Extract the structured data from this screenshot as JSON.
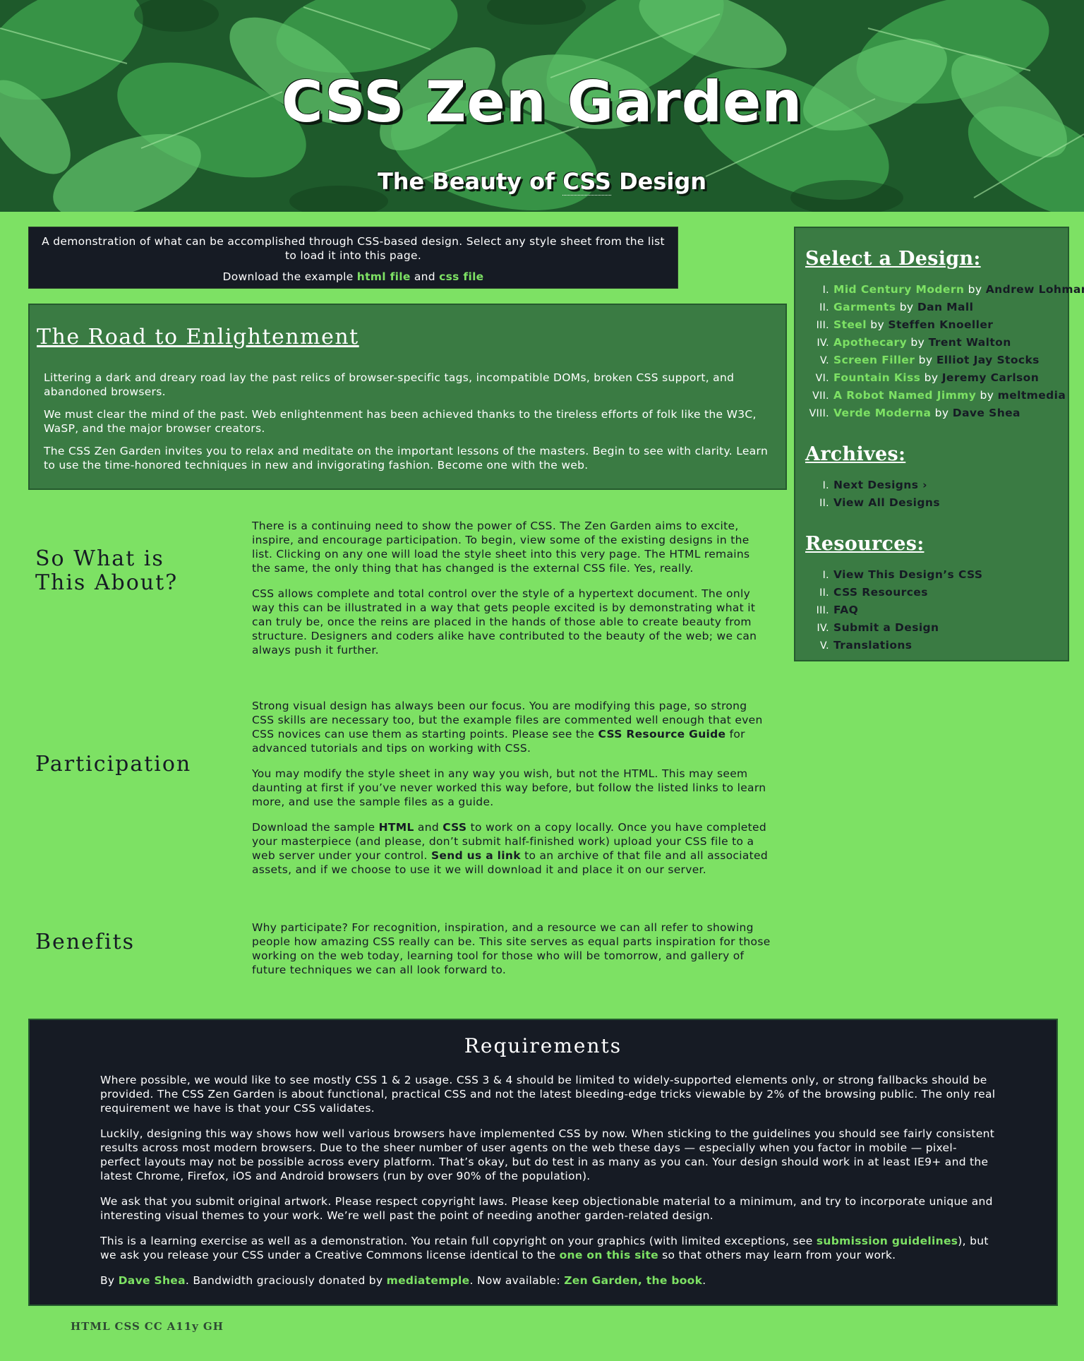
{
  "header": {
    "title": "CSS Zen Garden",
    "subtitle_prefix": "The Beauty of ",
    "subtitle_abbr": "CSS",
    "subtitle_suffix": " Design"
  },
  "intro": {
    "text": "A demonstration of what can be accomplished through CSS-based design. Select any style sheet from the list to load it into this page.",
    "download_prefix": "Download the example ",
    "html_link": "html file",
    "and": " and ",
    "css_link": "css file"
  },
  "road": {
    "title": "The Road to Enlightenment",
    "p1": "Littering a dark and dreary road lay the past relics of browser-specific tags, incompatible DOMs, broken CSS support, and abandoned browsers.",
    "p2": "We must clear the mind of the past. Web enlightenment has been achieved thanks to the tireless efforts of folk like the W3C, WaSP, and the major browser creators.",
    "p3": "The CSS Zen Garden invites you to relax and meditate on the important lessons of the masters. Begin to see with clarity. Learn to use the time-honored techniques in new and invigorating fashion. Become one with the web."
  },
  "about": {
    "title": "So What is This About?",
    "p1": "There is a continuing need to show the power of CSS. The Zen Garden aims to excite, inspire, and encourage participation. To begin, view some of the existing designs in the list. Clicking on any one will load the style sheet into this very page. The HTML remains the same, the only thing that has changed is the external CSS file. Yes, really.",
    "p2": "CSS allows complete and total control over the style of a hypertext document. The only way this can be illustrated in a way that gets people excited is by demonstrating what it can truly be, once the reins are placed in the hands of those able to create beauty from structure. Designers and coders alike have contributed to the beauty of the web; we can always push it further."
  },
  "participation": {
    "title": "Participation",
    "p1_a": "Strong visual design has always been our focus. You are modifying this page, so strong CSS skills are necessary too, but the example files are commented well enough that even CSS novices can use them as starting points. Please see the ",
    "p1_link": "CSS Resource Guide",
    "p1_b": " for advanced tutorials and tips on working with CSS.",
    "p2": "You may modify the style sheet in any way you wish, but not the HTML. This may seem daunting at first if you’ve never worked this way before, but follow the listed links to learn more, and use the sample files as a guide.",
    "p3_a": "Download the sample ",
    "p3_html": "HTML",
    "p3_and": " and ",
    "p3_css": "CSS",
    "p3_b": " to work on a copy locally. Once you have completed your masterpiece (and please, don’t submit half-finished work) upload your CSS file to a web server under your control. ",
    "p3_link": "Send us a link",
    "p3_c": " to an archive of that file and all associated assets, and if we choose to use it we will download it and place it on our server."
  },
  "benefits": {
    "title": "Benefits",
    "p1": "Why participate? For recognition, inspiration, and a resource we can all refer to showing people how amazing CSS really can be. This site serves as equal parts inspiration for those working on the web today, learning tool for those who will be tomorrow, and gallery of future techniques we can all look forward to."
  },
  "sidebar": {
    "select_title": "Select a Design:",
    "designs": [
      {
        "num": "I.",
        "name": "Mid Century Modern",
        "by": "by",
        "author": "Andrew Lohman"
      },
      {
        "num": "II.",
        "name": "Garments",
        "by": "by",
        "author": "Dan Mall"
      },
      {
        "num": "III.",
        "name": "Steel",
        "by": "by",
        "author": "Steffen Knoeller"
      },
      {
        "num": "IV.",
        "name": "Apothecary",
        "by": "by",
        "author": "Trent Walton"
      },
      {
        "num": "V.",
        "name": "Screen Filler",
        "by": "by",
        "author": "Elliot Jay Stocks"
      },
      {
        "num": "VI.",
        "name": "Fountain Kiss",
        "by": "by",
        "author": "Jeremy Carlson"
      },
      {
        "num": "VII.",
        "name": "A Robot Named Jimmy",
        "by": "by",
        "author": "meltmedia"
      },
      {
        "num": "VIII.",
        "name": "Verde Moderna",
        "by": "by",
        "author": "Dave Shea"
      }
    ],
    "archives_title": "Archives:",
    "archives": [
      {
        "num": "I.",
        "label": "Next Designs ›"
      },
      {
        "num": "II.",
        "label": "View All Designs"
      }
    ],
    "resources_title": "Resources:",
    "resources": [
      {
        "num": "I.",
        "label": "View This Design’s CSS"
      },
      {
        "num": "II.",
        "label": "CSS Resources"
      },
      {
        "num": "III.",
        "label": "FAQ"
      },
      {
        "num": "IV.",
        "label": "Submit a Design"
      },
      {
        "num": "V.",
        "label": "Translations"
      }
    ]
  },
  "requirements": {
    "title": "Requirements",
    "p1": "Where possible, we would like to see mostly CSS 1 & 2 usage. CSS 3 & 4 should be limited to widely-supported elements only, or strong fallbacks should be provided. The CSS Zen Garden is about functional, practical CSS and not the latest bleeding-edge tricks viewable by 2% of the browsing public. The only real requirement we have is that your CSS validates.",
    "p2": "Luckily, designing this way shows how well various browsers have implemented CSS by now. When sticking to the guidelines you should see fairly consistent results across most modern browsers. Due to the sheer number of user agents on the web these days — especially when you factor in mobile — pixel-perfect layouts may not be possible across every platform. That’s okay, but do test in as many as you can. Your design should work in at least IE9+ and the latest Chrome, Firefox, iOS and Android browsers (run by over 90% of the population).",
    "p3": "We ask that you submit original artwork. Please respect copyright laws. Please keep objectionable material to a minimum, and try to incorporate unique and interesting visual themes to your work. We’re well past the point of needing another garden-related design.",
    "p4_a": "This is a learning exercise as well as a demonstration. You retain full copyright on your graphics (with limited exceptions, see ",
    "p4_link1": "submission guidelines",
    "p4_b": "), but we ask you release your CSS under a Creative Commons license identical to the ",
    "p4_link2": "one on this site",
    "p4_c": " so that others may learn from your work.",
    "p5_a": "By ",
    "p5_link1": "Dave Shea",
    "p5_b": ". Bandwidth graciously donated by ",
    "p5_link2": "mediatemple",
    "p5_c": ". Now available: ",
    "p5_link3": "Zen Garden, the book",
    "p5_d": "."
  },
  "footer": {
    "links": [
      "HTML",
      "CSS",
      "CC",
      "A11y",
      "GH"
    ]
  },
  "colors": {
    "background": "#7de164",
    "panel_green": "#3a7b43",
    "panel_dark": "#161b24",
    "link_green": "#7de164"
  }
}
